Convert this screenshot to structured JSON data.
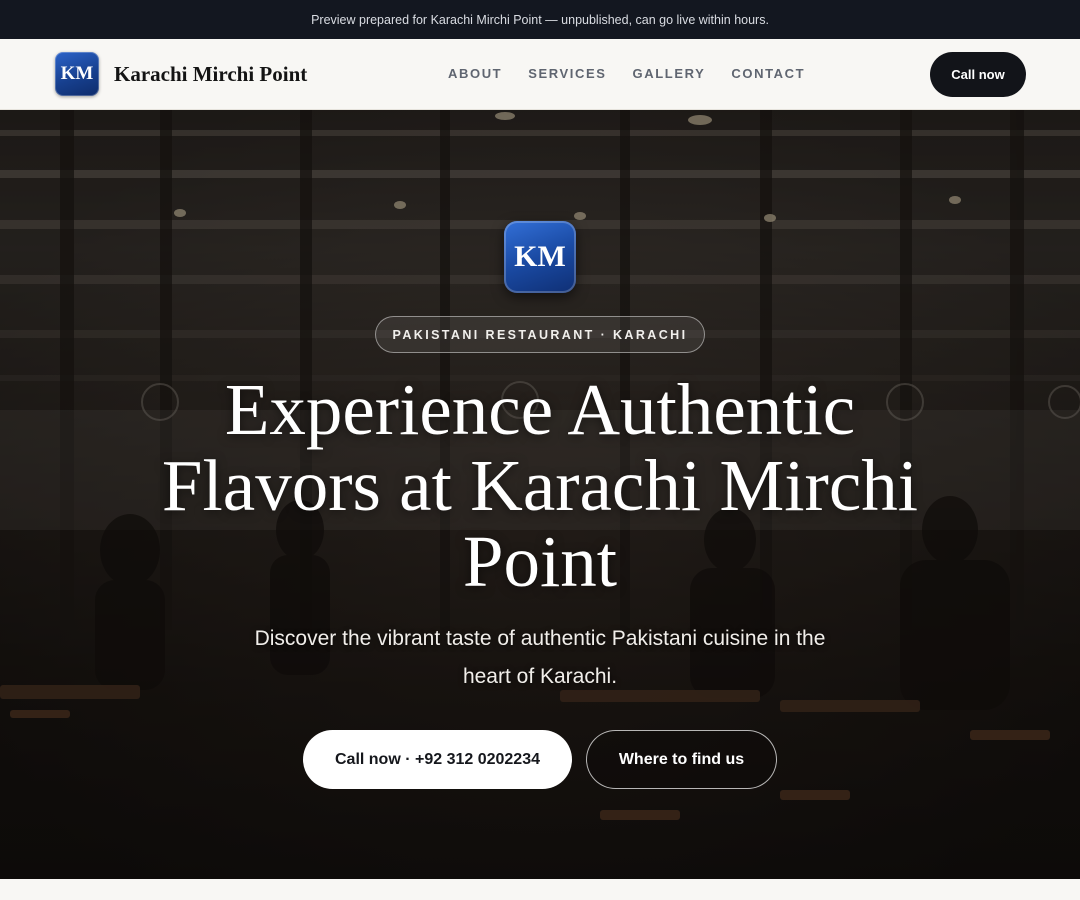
{
  "banner": {
    "text": "Preview prepared for Karachi Mirchi Point — unpublished, can go live within hours."
  },
  "header": {
    "logo_text": "KM",
    "brand_name": "Karachi Mirchi Point",
    "nav": [
      {
        "label": "ABOUT"
      },
      {
        "label": "SERVICES"
      },
      {
        "label": "GALLERY"
      },
      {
        "label": "CONTACT"
      }
    ],
    "call_label": "Call now"
  },
  "hero": {
    "logo_text": "KM",
    "tag": "PAKISTANI RESTAURANT · KARACHI",
    "headline": "Experience Authentic Flavors at Karachi Mirchi Point",
    "subheadline": "Discover the vibrant taste of authentic Pakistani cuisine in the heart of Karachi.",
    "primary_cta": "Call now · +92 312 0202234",
    "secondary_cta": "Where to find us"
  },
  "colors": {
    "banner_bg": "#131720",
    "header_bg": "#f8f7f4",
    "dark_button": "#121419",
    "logo_blue": "#1a4aa3"
  }
}
